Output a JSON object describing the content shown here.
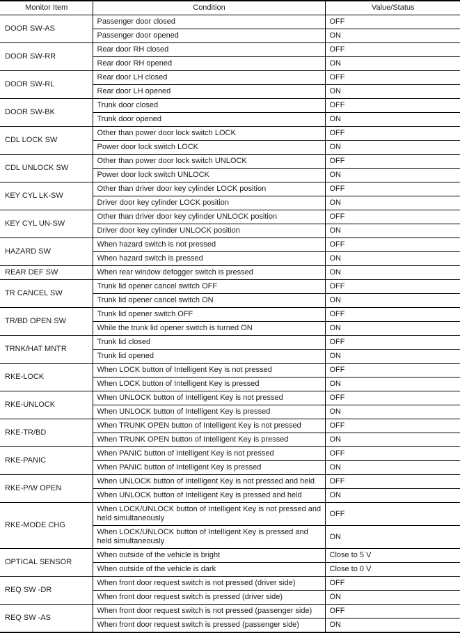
{
  "table": {
    "headers": [
      "Monitor Item",
      "Condition",
      "Value/Status"
    ],
    "groups": [
      {
        "item": "DOOR SW-AS",
        "rows": [
          {
            "condition": "Passenger door closed",
            "value": "OFF"
          },
          {
            "condition": "Passenger door opened",
            "value": "ON"
          }
        ]
      },
      {
        "item": "DOOR SW-RR",
        "rows": [
          {
            "condition": "Rear door RH closed",
            "value": "OFF"
          },
          {
            "condition": "Rear door RH opened",
            "value": "ON"
          }
        ]
      },
      {
        "item": "DOOR SW-RL",
        "rows": [
          {
            "condition": "Rear door LH closed",
            "value": "OFF"
          },
          {
            "condition": "Rear door LH opened",
            "value": "ON"
          }
        ]
      },
      {
        "item": "DOOR SW-BK",
        "rows": [
          {
            "condition": "Trunk door closed",
            "value": "OFF"
          },
          {
            "condition": "Trunk door opened",
            "value": "ON"
          }
        ]
      },
      {
        "item": "CDL LOCK SW",
        "rows": [
          {
            "condition": "Other than power door lock switch LOCK",
            "value": "OFF"
          },
          {
            "condition": "Power door lock switch LOCK",
            "value": "ON"
          }
        ]
      },
      {
        "item": "CDL UNLOCK SW",
        "rows": [
          {
            "condition": "Other than power door lock switch UNLOCK",
            "value": "OFF"
          },
          {
            "condition": "Power door lock switch UNLOCK",
            "value": "ON"
          }
        ]
      },
      {
        "item": "KEY CYL LK-SW",
        "rows": [
          {
            "condition": "Other than driver door key cylinder LOCK position",
            "value": "OFF"
          },
          {
            "condition": "Driver door key cylinder LOCK position",
            "value": "ON"
          }
        ]
      },
      {
        "item": "KEY CYL UN-SW",
        "rows": [
          {
            "condition": "Other than driver door key cylinder UNLOCK position",
            "value": "OFF"
          },
          {
            "condition": "Driver door key cylinder UNLOCK position",
            "value": "ON"
          }
        ]
      },
      {
        "item": "HAZARD SW",
        "rows": [
          {
            "condition": "When hazard switch is not pressed",
            "value": "OFF"
          },
          {
            "condition": "When hazard switch is pressed",
            "value": "ON"
          }
        ]
      },
      {
        "item": "REAR DEF SW",
        "rows": [
          {
            "condition": "When rear window defogger switch is pressed",
            "value": "ON"
          }
        ]
      },
      {
        "item": "TR CANCEL SW",
        "rows": [
          {
            "condition": "Trunk lid opener cancel switch OFF",
            "value": "OFF"
          },
          {
            "condition": "Trunk lid opener cancel switch ON",
            "value": "ON"
          }
        ]
      },
      {
        "item": "TR/BD OPEN SW",
        "rows": [
          {
            "condition": "Trunk lid opener switch OFF",
            "value": "OFF"
          },
          {
            "condition": "While the trunk lid opener switch is turned ON",
            "value": "ON"
          }
        ]
      },
      {
        "item": "TRNK/HAT MNTR",
        "rows": [
          {
            "condition": "Trunk lid closed",
            "value": "OFF"
          },
          {
            "condition": "Trunk lid opened",
            "value": "ON"
          }
        ]
      },
      {
        "item": "RKE-LOCK",
        "rows": [
          {
            "condition": "When LOCK button of Intelligent Key is not pressed",
            "value": "OFF"
          },
          {
            "condition": "When LOCK button of Intelligent Key is pressed",
            "value": "ON"
          }
        ]
      },
      {
        "item": "RKE-UNLOCK",
        "rows": [
          {
            "condition": "When UNLOCK button of Intelligent Key is not pressed",
            "value": "OFF"
          },
          {
            "condition": "When UNLOCK button of Intelligent Key is pressed",
            "value": "ON"
          }
        ]
      },
      {
        "item": "RKE-TR/BD",
        "rows": [
          {
            "condition": "When TRUNK OPEN button of Intelligent Key is not pressed",
            "value": "OFF"
          },
          {
            "condition": "When TRUNK OPEN button of Intelligent Key is pressed",
            "value": "ON"
          }
        ]
      },
      {
        "item": "RKE-PANIC",
        "rows": [
          {
            "condition": "When PANIC button of Intelligent Key is not pressed",
            "value": "OFF"
          },
          {
            "condition": "When PANIC button of Intelligent Key is pressed",
            "value": "ON"
          }
        ]
      },
      {
        "item": "RKE-P/W OPEN",
        "rows": [
          {
            "condition": "When UNLOCK button of Intelligent Key is not pressed and held",
            "value": "OFF"
          },
          {
            "condition": "When UNLOCK button of Intelligent Key is pressed and held",
            "value": "ON"
          }
        ]
      },
      {
        "item": "RKE-MODE CHG",
        "rows": [
          {
            "condition": "When LOCK/UNLOCK button of Intelligent Key is not pressed and held simultaneously",
            "value": "OFF",
            "tall": true
          },
          {
            "condition": "When LOCK/UNLOCK button of Intelligent Key is pressed and held simultaneously",
            "value": "ON",
            "tall": true
          }
        ]
      },
      {
        "item": "OPTICAL SENSOR",
        "rows": [
          {
            "condition": "When outside of the vehicle is bright",
            "value": "Close to 5 V"
          },
          {
            "condition": "When outside of the vehicle is dark",
            "value": "Close to 0 V"
          }
        ]
      },
      {
        "item": "REQ SW -DR",
        "rows": [
          {
            "condition": "When front door request switch is not pressed (driver side)",
            "value": "OFF"
          },
          {
            "condition": "When front door request switch is pressed (driver side)",
            "value": "ON"
          }
        ]
      },
      {
        "item": "REQ SW -AS",
        "rows": [
          {
            "condition": "When front door request switch is not pressed (passenger side)",
            "value": "OFF"
          },
          {
            "condition": "When front door request switch is pressed (passenger side)",
            "value": "ON"
          }
        ]
      }
    ]
  }
}
